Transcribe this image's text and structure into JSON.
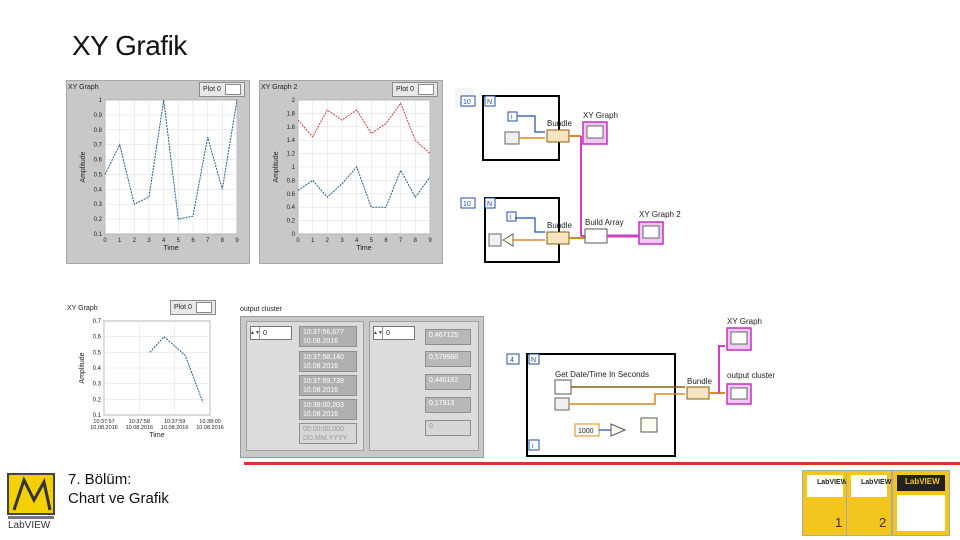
{
  "slide": {
    "title": "XY Grafik",
    "footer_line1": "7. Bölüm:",
    "footer_line2": "Chart ve Grafik",
    "logo_text": "LabVIEW"
  },
  "graph1": {
    "title": "XY Graph",
    "plot_label": "Plot 0",
    "xlabel": "Time",
    "ylabel": "Amplitude",
    "yticks": [
      "1",
      "0.9",
      "0.8",
      "0.7",
      "0.6",
      "0.5",
      "0.4",
      "0.3",
      "0.2",
      "0.1"
    ],
    "xticks": [
      "0",
      "1",
      "2",
      "3",
      "4",
      "5",
      "6",
      "7",
      "8",
      "9"
    ]
  },
  "graph2": {
    "title": "XY Graph 2",
    "plot_label": "Plot 0",
    "xlabel": "Time",
    "ylabel": "Amplitude",
    "yticks": [
      "2",
      "1.8",
      "1.6",
      "1.4",
      "1.2",
      "1",
      "0.8",
      "0.6",
      "0.4",
      "0.2",
      "0"
    ],
    "xticks": [
      "0",
      "1",
      "2",
      "3",
      "4",
      "5",
      "6",
      "7",
      "8",
      "9"
    ]
  },
  "graph3": {
    "title": "XY Graph",
    "plot_label": "Plot 0",
    "xlabel": "Time",
    "ylabel": "Amplitude",
    "yticks": [
      "0.7",
      "0.6",
      "0.5",
      "0.4",
      "0.3",
      "0.2",
      "0.1"
    ],
    "xticks": [
      {
        "t": "10:37:57",
        "d": "10.08.2016"
      },
      {
        "t": "10:37:58",
        "d": "10.08.2016"
      },
      {
        "t": "10:37:59",
        "d": "10.08.2016"
      },
      {
        "t": "10:38:00",
        "d": "10.08.2016"
      }
    ]
  },
  "cluster": {
    "title": "output cluster",
    "index_left": "0",
    "index_right": "0",
    "timestamps": [
      {
        "time": "10:37:56,677",
        "date": "10.08.2016"
      },
      {
        "time": "10:37:58,140",
        "date": "10.08.2016"
      },
      {
        "time": "10:37:59,739",
        "date": "10.08.2016"
      },
      {
        "time": "10:38:00,203",
        "date": "10.08.2016"
      },
      {
        "time": "00:00:00,000",
        "date": "DD.MM.YYYY"
      }
    ],
    "values": [
      "0,467125",
      "0,579960",
      "0,440182",
      "0,17913",
      "0"
    ]
  },
  "diagram": {
    "top": {
      "loop_count": "10",
      "n_label": "N",
      "i_label": "i",
      "bundle_label": "Bundle",
      "indicator_label": "XY Graph"
    },
    "middle": {
      "loop_count": "10",
      "n_label": "N",
      "i_label": "i",
      "bundle_label": "Bundle",
      "build_array_label": "Build Array",
      "indicator_label": "XY Graph 2"
    },
    "bottom": {
      "loop_count": "4",
      "n_label": "N",
      "i_label": "i",
      "get_time_label": "Get Date/Time In Seconds",
      "bundle_label": "Bundle",
      "wait_value": "1000",
      "indicator1_label": "XY Graph",
      "indicator2_label": "output cluster"
    }
  },
  "books": [
    {
      "brand": "LabVIEW",
      "number": "1"
    },
    {
      "brand": "LabVIEW",
      "number": "2"
    },
    {
      "brand": "LabVIEW",
      "number": ""
    }
  ],
  "colors": {
    "blue_plot": "#1f5f8b",
    "red_plot": "#d04040",
    "wire_orange": "#d98a1a",
    "wire_pink": "#d040c0",
    "accent_red": "#e03030"
  }
}
